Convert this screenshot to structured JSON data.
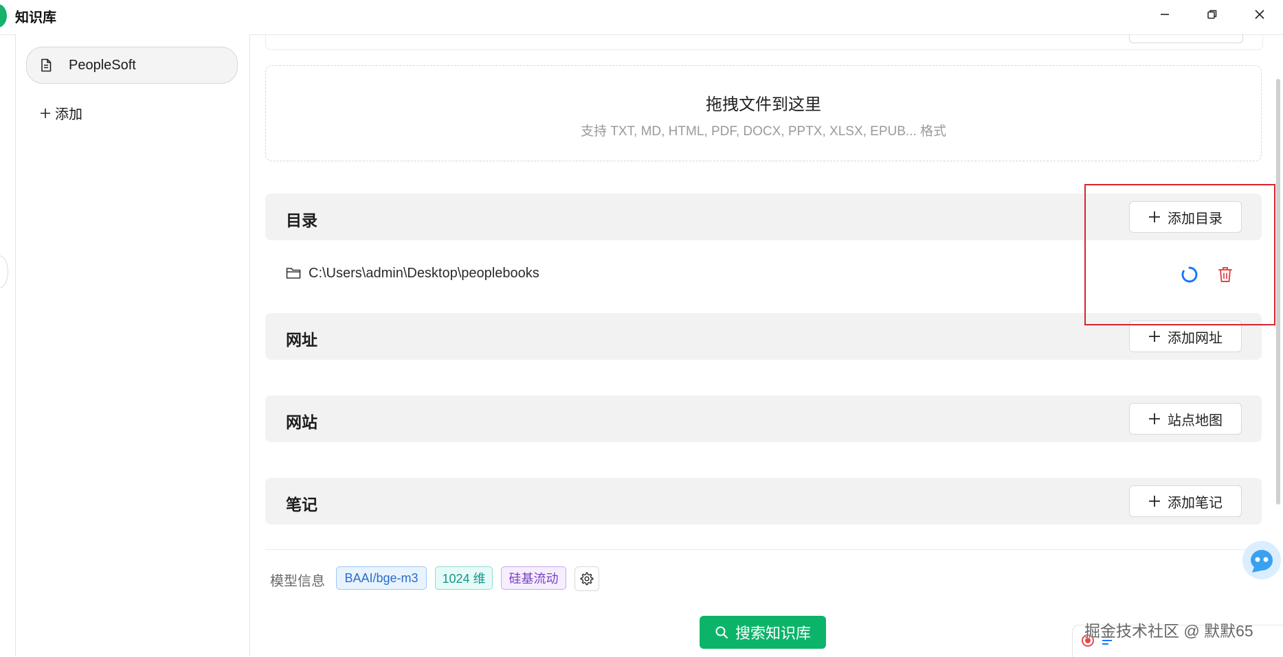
{
  "window": {
    "title": "知识库",
    "controls": [
      "minimize-icon",
      "restore-icon",
      "close-icon"
    ]
  },
  "sidebar": {
    "items": [
      {
        "label": "PeopleSoft",
        "icon": "document-icon",
        "selected": true
      }
    ],
    "add_label": "添加"
  },
  "dropzone": {
    "title": "拖拽文件到这里",
    "hint": "支持 TXT, MD, HTML, PDF, DOCX, PPTX, XLSX, EPUB... 格式"
  },
  "sections": {
    "directory": {
      "title": "目录",
      "button": "添加目录",
      "items": [
        {
          "path": "C:\\Users\\admin\\Desktop\\peoplebooks",
          "status": "processing"
        }
      ]
    },
    "url": {
      "title": "网址",
      "button": "添加网址"
    },
    "website": {
      "title": "网站",
      "button": "站点地图"
    },
    "notes": {
      "title": "笔记",
      "button": "添加笔记"
    }
  },
  "model_info": {
    "label": "模型信息",
    "model": "BAAI/bge-m3",
    "dimensions": "1024 维",
    "provider": "硅基流动"
  },
  "search_button": "搜索知识库",
  "watermark": "掘金技术社区 @ 默默65",
  "colors": {
    "accent": "#0cb46a",
    "highlight": "#d8232a",
    "spinner": "#1677ff",
    "delete": "#e5484d"
  }
}
